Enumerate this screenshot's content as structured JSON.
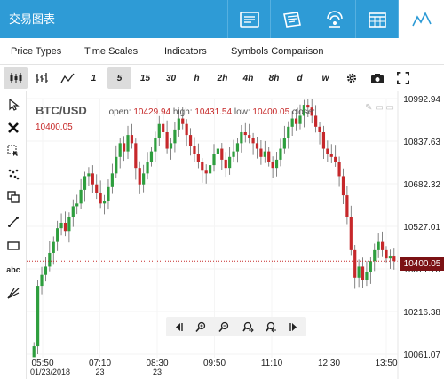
{
  "header": {
    "title": "交易图表",
    "tabs": [
      {
        "icon": "ticket-icon"
      },
      {
        "icon": "newspaper-icon"
      },
      {
        "icon": "signal-icon"
      },
      {
        "icon": "calendar-icon"
      },
      {
        "icon": "line-chart-icon",
        "active": true
      }
    ]
  },
  "menu": [
    "Price Types",
    "Time Scales",
    "Indicators",
    "Symbols Comparison"
  ],
  "toolbar": {
    "chart_types": [
      "candlestick-icon",
      "ohlc-bars-icon",
      "line-icon"
    ],
    "timeframes": [
      "1",
      "5",
      "15",
      "30",
      "h",
      "2h",
      "4h",
      "8h",
      "d",
      "w"
    ],
    "selected_timeframe": "5",
    "actions": [
      "gear-icon",
      "camera-icon",
      "fullscreen-icon"
    ]
  },
  "left_tools": [
    "cursor-icon",
    "delete-icon",
    "select-region-icon",
    "dots-icon",
    "copy-icon",
    "trendline-icon",
    "rectangle-icon",
    "abc",
    "fibonacci-icon"
  ],
  "legend": {
    "symbol": "BTC/USD",
    "open_label": "open:",
    "open": "10429.94",
    "high_label": "high:",
    "high": "10431.54",
    "low_label": "low:",
    "low": "10400.05",
    "close_label": "close:",
    "close": "10400.05"
  },
  "current_price": "10400.05",
  "colors": {
    "up": "#2e9e3e",
    "down": "#c6282b",
    "accent": "#2e9bd6",
    "price_tag": "#7b1114"
  },
  "chart_data": {
    "type": "candlestick",
    "y_ticks": [
      "10992.94",
      "10837.63",
      "10682.32",
      "10527.01",
      "10371.70",
      "10216.38",
      "10061.07"
    ],
    "x_ticks": [
      "05:50",
      "07:10",
      "08:30",
      "09:50",
      "11:10",
      "12:30",
      "13:50"
    ],
    "x_dates": [
      "01/23/2018",
      "23",
      "23"
    ],
    "ylim": [
      10061.07,
      10992.94
    ],
    "closes": [
      10090,
      10310,
      10350,
      10380,
      10430,
      10470,
      10520,
      10540,
      10510,
      10560,
      10600,
      10610,
      10660,
      10710,
      10720,
      10680,
      10650,
      10610,
      10620,
      10670,
      10720,
      10780,
      10830,
      10800,
      10860,
      10830,
      10740,
      10680,
      10720,
      10760,
      10800,
      10850,
      10900,
      10870,
      10810,
      10830,
      10880,
      10920,
      10900,
      10860,
      10820,
      10790,
      10760,
      10730,
      10720,
      10750,
      10790,
      10810,
      10770,
      10740,
      10780,
      10800,
      10830,
      10870,
      10860,
      10850,
      10830,
      10810,
      10780,
      10800,
      10760,
      10740,
      10770,
      10810,
      10850,
      10890,
      10920,
      10900,
      10930,
      10970,
      10960,
      10930,
      10890,
      10870,
      10810,
      10790,
      10780,
      10760,
      10710,
      10640,
      10560,
      10440,
      10340,
      10380,
      10330,
      10360,
      10400,
      10440,
      10470,
      10440,
      10410,
      10420,
      10400
    ]
  },
  "navigation": [
    "scroll-left-icon",
    "zoom-in-icon",
    "zoom-out-icon",
    "zoom-fit-icon",
    "zoom-reset-icon",
    "scroll-right-icon"
  ]
}
